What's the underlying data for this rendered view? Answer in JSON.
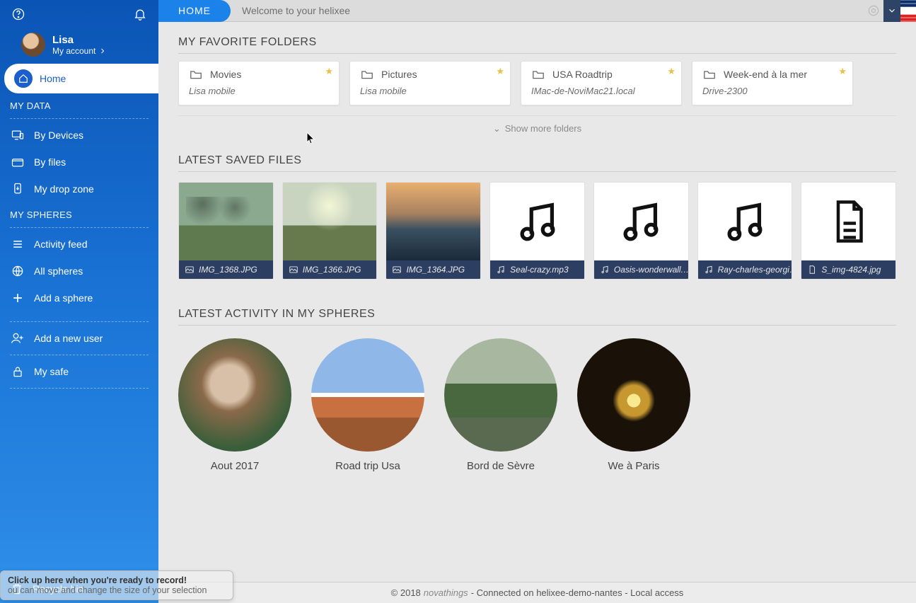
{
  "sidebar": {
    "user_name": "Lisa",
    "my_account": "My account",
    "home": "Home",
    "my_data": "MY DATA",
    "by_devices": "By Devices",
    "by_files": "By files",
    "my_drop_zone": "My drop zone",
    "my_spheres": "MY SPHERES",
    "activity_feed": "Activity feed",
    "all_spheres": "All spheres",
    "add_sphere": "Add a sphere",
    "add_user": "Add a new user",
    "my_safe": "My safe",
    "recycle_bin": "Recycle bin"
  },
  "topbar": {
    "home_tab": "HOME",
    "welcome": "Welcome to your helixee"
  },
  "sections": {
    "fav_folders": "MY FAVORITE FOLDERS",
    "latest_files": "LATEST SAVED FILES",
    "latest_activity": "LATEST ACTIVITY IN MY SPHERES",
    "show_more": "Show more folders"
  },
  "folders": [
    {
      "name": "Movies",
      "sub": "Lisa mobile"
    },
    {
      "name": "Pictures",
      "sub": "Lisa mobile"
    },
    {
      "name": "USA Roadtrip",
      "sub": "IMac-de-NoviMac21.local"
    },
    {
      "name": "Week-end à la mer",
      "sub": "Drive-2300"
    }
  ],
  "files": [
    {
      "name": "IMG_1368.JPG",
      "type": "image"
    },
    {
      "name": "IMG_1366.JPG",
      "type": "image"
    },
    {
      "name": "IMG_1364.JPG",
      "type": "image"
    },
    {
      "name": "Seal-crazy.mp3",
      "type": "audio"
    },
    {
      "name": "Oasis-wonderwall.…",
      "type": "audio"
    },
    {
      "name": "Ray-charles-georgi…",
      "type": "audio"
    },
    {
      "name": "S_img-4824.jpg",
      "type": "doc"
    }
  ],
  "spheres": [
    {
      "name": "Aout 2017"
    },
    {
      "name": "Road trip Usa"
    },
    {
      "name": "Bord de Sèvre"
    },
    {
      "name": "We à Paris"
    }
  ],
  "footer": {
    "copyright": "© 2018",
    "brand": "novathings",
    "conn": "- Connected on helixee-demo-nantes - Local access"
  },
  "overlay": {
    "line1": "Click up here when you're ready to record!",
    "line2": "ou can move and change the size of your selection"
  }
}
